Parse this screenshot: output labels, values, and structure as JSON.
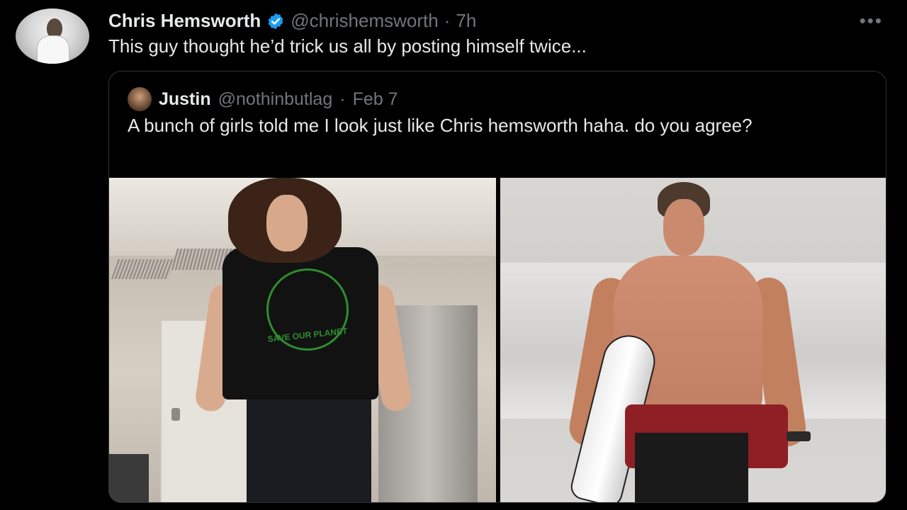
{
  "tweet": {
    "author_name": "Chris Hemsworth",
    "handle": "@chrishemsworth",
    "separator": "·",
    "time": "7h",
    "text": "This guy thought he’d trick us all by posting himself twice...",
    "more_label": "•••"
  },
  "quoted_tweet": {
    "author_name": "Justin",
    "handle": "@nothinbutlag",
    "separator": "·",
    "date": "Feb 7",
    "text": "A bunch of girls told me I look just like Chris hemsworth haha. do you agree?",
    "shirt_text": "SAVE OUR PLANET"
  },
  "colors": {
    "background": "#000000",
    "text_primary": "#e7e9ea",
    "text_secondary": "#71767b",
    "verified": "#1d9bf0",
    "border": "#2f3336"
  },
  "icons": {
    "verified": "verified-badge-icon",
    "more": "more-options-icon"
  }
}
